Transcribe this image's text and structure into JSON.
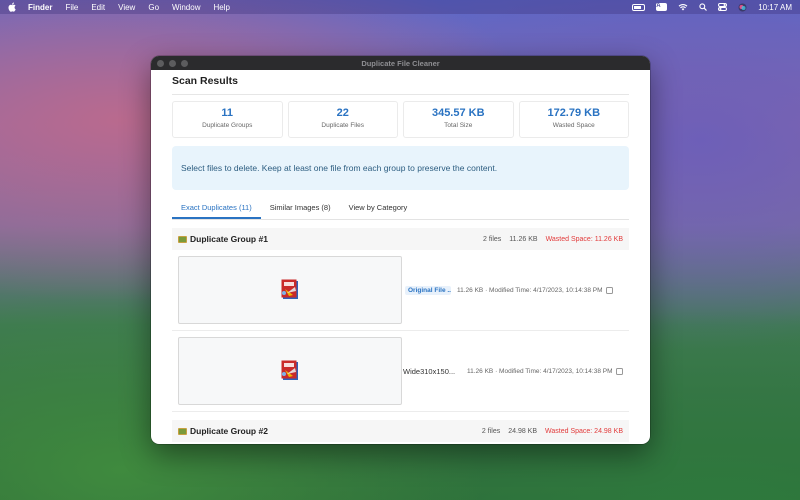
{
  "menubar": {
    "app": "Finder",
    "items": [
      "File",
      "Edit",
      "View",
      "Go",
      "Window",
      "Help"
    ],
    "keyboard_badge": "A",
    "clock": "10:17 AM"
  },
  "window": {
    "title": "Duplicate File Cleaner"
  },
  "results": {
    "title": "Scan Results",
    "stats": [
      {
        "value": "11",
        "label": "Duplicate Groups"
      },
      {
        "value": "22",
        "label": "Duplicate Files"
      },
      {
        "value": "345.57 KB",
        "label": "Total Size"
      },
      {
        "value": "172.79 KB",
        "label": "Wasted Space"
      }
    ],
    "info": "Select files to delete. Keep at least one file from each group to preserve the content."
  },
  "tabs": [
    {
      "label": "Exact Duplicates (11)",
      "active": true
    },
    {
      "label": "Similar Images (8)",
      "active": false
    },
    {
      "label": "View by Category",
      "active": false
    }
  ],
  "groups": [
    {
      "title": "Duplicate Group #1",
      "files_count": "2 files",
      "size": "11.26 KB",
      "wasted": "Wasted Space: 11.26 KB",
      "files": [
        {
          "name": "Original File ...",
          "meta": "11.26 KB · Modified Time: 4/17/2023, 10:14:38 PM",
          "original": true
        },
        {
          "name": "Wide310x150...",
          "meta": "11.26 KB · Modified Time: 4/17/2023, 10:14:38 PM",
          "original": false
        }
      ]
    },
    {
      "title": "Duplicate Group #2",
      "files_count": "2 files",
      "size": "24.98 KB",
      "wasted": "Wasted Space: 24.98 KB"
    }
  ],
  "colors": {
    "accent": "#2a73c2",
    "danger": "#e23b3b",
    "info_bg": "#e8f4fc"
  }
}
